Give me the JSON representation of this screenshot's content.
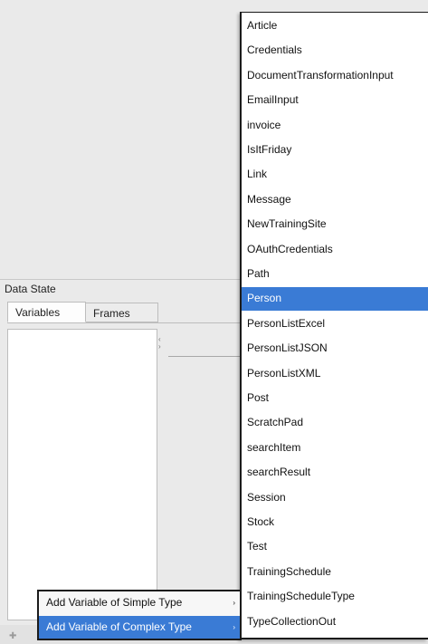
{
  "panel": {
    "title": "Data State",
    "tabs": [
      "Variables",
      "Frames"
    ],
    "splitter_glyph_top": "‹",
    "splitter_glyph_bottom": "›",
    "add_glyph": "✚"
  },
  "type_menu": {
    "selected_index": 11,
    "items": [
      "Article",
      "Credentials",
      "DocumentTransformationInput",
      "EmailInput",
      "invoice",
      "IsItFriday",
      "Link",
      "Message",
      "NewTrainingSite",
      "OAuthCredentials",
      "Path",
      "Person",
      "PersonListExcel",
      "PersonListJSON",
      "PersonListXML",
      "Post",
      "ScratchPad",
      "searchItem",
      "searchResult",
      "Session",
      "Stock",
      "Test",
      "TrainingSchedule",
      "TrainingScheduleType",
      "TypeCollectionOut"
    ]
  },
  "context_menu": {
    "items": [
      {
        "label": "Add Variable of Simple Type",
        "arrow": "›"
      },
      {
        "label": "Add Variable of Complex Type",
        "arrow": "›"
      }
    ],
    "selected_index": 1
  },
  "colors": {
    "selection": "#3a7bd5",
    "background": "#eaeaea",
    "menu_border": "#1b1b1b"
  }
}
